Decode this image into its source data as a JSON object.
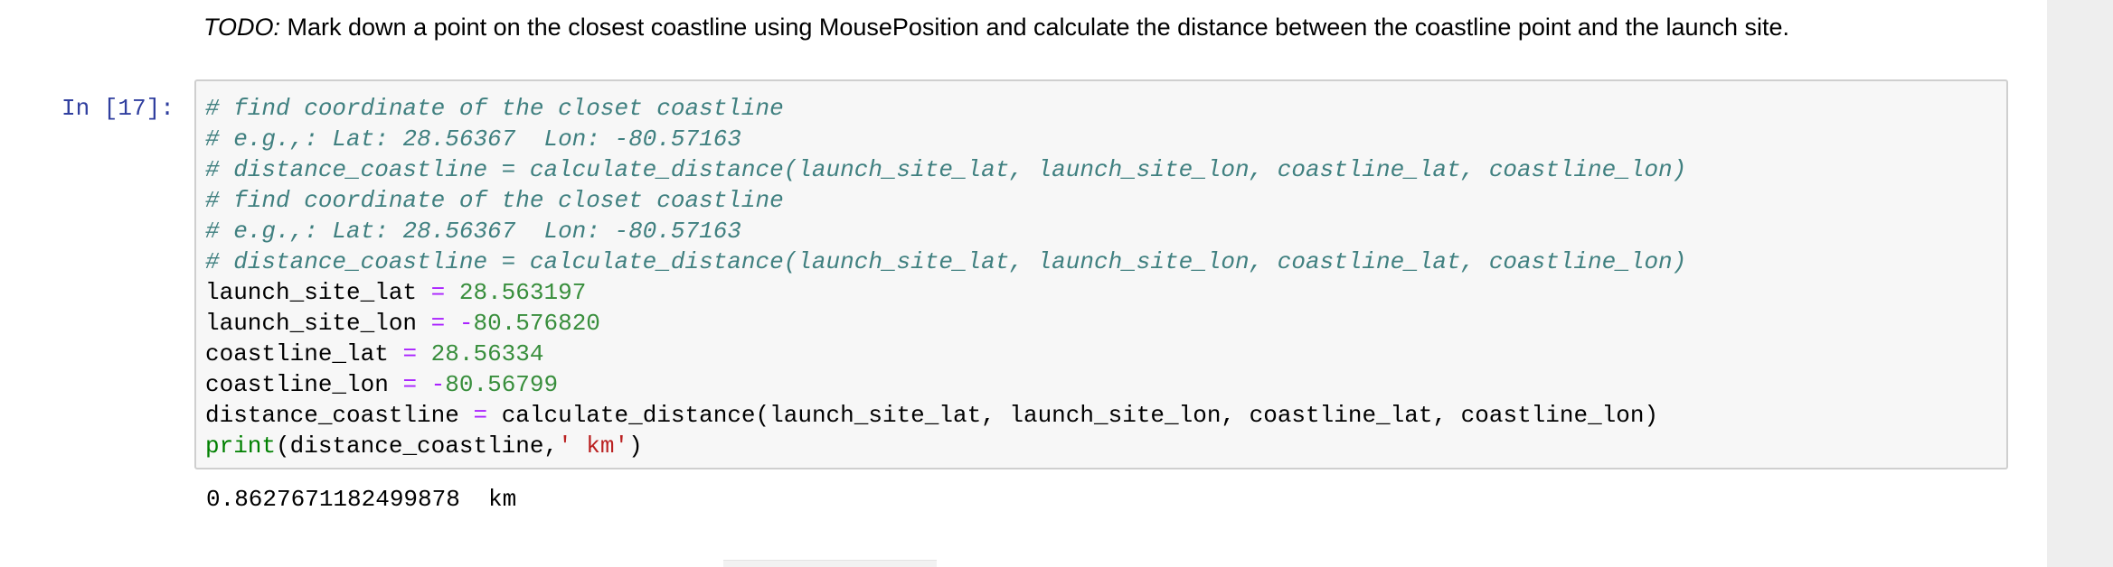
{
  "markdown": {
    "todo_label": "TODO:",
    "todo_text": " Mark down a point on the closest coastline using MousePosition and calculate the distance between the coastline point and the launch site."
  },
  "cell": {
    "prompt": "In [17]:",
    "lines": [
      {
        "comment": "# find coordinate of the closet coastline"
      },
      {
        "comment": "# e.g.,: Lat: 28.56367  Lon: -80.57163"
      },
      {
        "comment": "# distance_coastline = calculate_distance(launch_site_lat, launch_site_lon, coastline_lat, coastline_lon)"
      },
      {
        "comment": "# find coordinate of the closet coastline"
      },
      {
        "comment": "# e.g.,: Lat: 28.56367  Lon: -80.57163"
      },
      {
        "comment": "# distance_coastline = calculate_distance(launch_site_lat, launch_site_lon, coastline_lat, coastline_lon)"
      },
      {
        "var": "launch_site_lat",
        "op": "=",
        "sign": "",
        "value": "28.563197"
      },
      {
        "var": "launch_site_lon",
        "op": "=",
        "sign": "-",
        "value": "80.576820"
      },
      {
        "var": "coastline_lat",
        "op": "=",
        "sign": "",
        "value": "28.56334"
      },
      {
        "var": "coastline_lon",
        "op": "=",
        "sign": "-",
        "value": "80.56799"
      },
      {
        "var": "distance_coastline",
        "op": "=",
        "call": "calculate_distance(launch_site_lat, launch_site_lon, coastline_lat, coastline_lon)"
      },
      {
        "builtin": "print",
        "args": "(distance_coastline,",
        "str": "' km'",
        "close": ")"
      }
    ],
    "output": "0.8627671182499878  km"
  },
  "colors": {
    "prompt": "#303f9f",
    "comment": "#408080",
    "operator": "#aa22ff",
    "number": "#388e3c",
    "builtin": "#008000",
    "string": "#ba2121",
    "cell_background": "#f7f7f7",
    "cell_border": "#cfcfcf"
  }
}
